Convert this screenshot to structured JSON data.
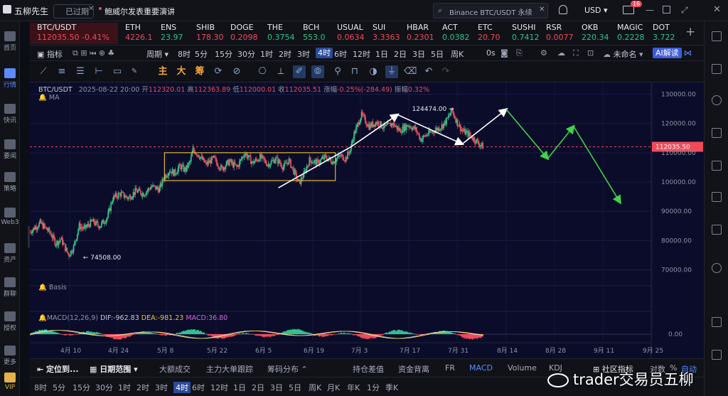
{
  "topbar": {
    "app_name": "五柳先生",
    "status": "已过期",
    "news": "鲍威尔发表重要演讲",
    "search_placeholder": "Binance BTC/USDT 永续",
    "currency": "USD",
    "notification_count": "16"
  },
  "leftnav": [
    {
      "label": "首页"
    },
    {
      "label": "行情"
    },
    {
      "label": "快讯"
    },
    {
      "label": "要闻"
    },
    {
      "label": "策略"
    },
    {
      "label": "Web3"
    },
    {
      "label": "资产"
    },
    {
      "label": "群聊"
    },
    {
      "label": "授权"
    },
    {
      "label": "更多"
    },
    {
      "label": "VIP"
    }
  ],
  "tickers": [
    {
      "name": "BTC/USDT",
      "price": "112035.50",
      "change": "-0.41%"
    },
    {
      "name": "ETH",
      "price": "4226.1"
    },
    {
      "name": "ENS",
      "price": "23.97"
    },
    {
      "name": "SHIB",
      "price": "178.30"
    },
    {
      "name": "DOGE",
      "price": "0.2098"
    },
    {
      "name": "THE",
      "price": "0.3754"
    },
    {
      "name": "BCH",
      "price": "553.0"
    },
    {
      "name": "USUAL",
      "price": "0.0634"
    },
    {
      "name": "SUI",
      "price": "3.3363"
    },
    {
      "name": "HBAR",
      "price": "0.2301"
    },
    {
      "name": "ACT",
      "price": "0.0382"
    },
    {
      "name": "ETC",
      "price": "20.70"
    },
    {
      "name": "SUSHI",
      "price": "0.7412"
    },
    {
      "name": "RSR",
      "price": "0.0077"
    },
    {
      "name": "OKB",
      "price": "220.34"
    },
    {
      "name": "MAGIC",
      "price": "0.2228"
    },
    {
      "name": "DOT",
      "price": "3.722"
    }
  ],
  "timeframes": {
    "indicator": "指标",
    "period": "周期",
    "items": [
      "8时",
      "5分",
      "15分",
      "30分",
      "1时",
      "2时",
      "3时",
      "4时",
      "6时",
      "12时",
      "1日",
      "2日",
      "3日",
      "5日",
      "周K"
    ],
    "active": "4时",
    "seconds": "0s",
    "layout_name": "未命名",
    "ai_label": "AI解读"
  },
  "tools": {
    "cn": [
      "主",
      "大",
      "筹"
    ]
  },
  "chart_info": {
    "symbol": "BTC/USDT",
    "time": "2025-08-22 20:00",
    "open_label": "开",
    "open": "112320.01",
    "high_label": "高",
    "high": "112363.89",
    "low_label": "低",
    "low": "112000.01",
    "close_label": "收",
    "close": "112035.51",
    "change_label": "涨幅",
    "change": "-0.25%(-284.49)",
    "amp_label": "振幅",
    "amp": "0.32%",
    "ma_label": "MA",
    "basis_label": "Basis",
    "macd_label": "MACD(12,26,9)",
    "dif": "DIF:-962.83",
    "dea": "DEA:-981.23",
    "macd": "MACD:36.80",
    "macd_zero": "0.00"
  },
  "chart_data": {
    "type": "candlestick",
    "y_ticks": [
      70000,
      80000,
      90000,
      100000,
      110000,
      120000,
      130000
    ],
    "y_tick_labels": [
      "70000.00",
      "80000.00",
      "90000.00",
      "100000.00",
      "110000.00",
      "120000.00",
      "130000.00"
    ],
    "x_tick_labels": [
      "4月 10",
      "4月 24",
      "5月 8",
      "5月 22",
      "6月 5",
      "6月 19",
      "7月 3",
      "7月 17",
      "7月 31",
      "8月 14",
      "8月 28",
      "9月 11",
      "9月 25"
    ],
    "ylim": [
      66000,
      134000
    ],
    "low_marker": {
      "label": "74508.00",
      "value": 74508
    },
    "high_marker": {
      "label": "124474.00",
      "value": 124474
    },
    "last_price": 112035.5,
    "last_price_label": "112035.50",
    "price_path": [
      [
        0,
        83000
      ],
      [
        4,
        86000
      ],
      [
        8,
        82500
      ],
      [
        10,
        79000
      ],
      [
        12,
        80500
      ],
      [
        15,
        75000
      ],
      [
        17,
        78000
      ],
      [
        19,
        85000
      ],
      [
        21,
        84000
      ],
      [
        24,
        86500
      ],
      [
        27,
        85000
      ],
      [
        30,
        88000
      ],
      [
        32,
        94500
      ],
      [
        35,
        96000
      ],
      [
        38,
        94500
      ],
      [
        41,
        97000
      ],
      [
        44,
        96000
      ],
      [
        47,
        98500
      ],
      [
        50,
        97500
      ],
      [
        52,
        102000
      ],
      [
        54,
        104000
      ],
      [
        56,
        103000
      ],
      [
        58,
        105500
      ],
      [
        60,
        104000
      ],
      [
        62,
        107000
      ],
      [
        63,
        111000
      ],
      [
        65,
        109500
      ],
      [
        68,
        106000
      ],
      [
        71,
        108000
      ],
      [
        74,
        104500
      ],
      [
        77,
        107000
      ],
      [
        80,
        105000
      ],
      [
        83,
        110000
      ],
      [
        86,
        106500
      ],
      [
        89,
        108500
      ],
      [
        92,
        106000
      ],
      [
        95,
        108000
      ],
      [
        98,
        105000
      ],
      [
        100,
        107500
      ],
      [
        102,
        103500
      ],
      [
        104,
        99500
      ],
      [
        106,
        103000
      ],
      [
        108,
        107500
      ],
      [
        111,
        106500
      ],
      [
        114,
        108500
      ],
      [
        117,
        107000
      ],
      [
        120,
        109000
      ],
      [
        122,
        108000
      ],
      [
        124,
        111500
      ],
      [
        125,
        116000
      ],
      [
        126,
        118000
      ],
      [
        128,
        123000
      ],
      [
        131,
        119000
      ],
      [
        134,
        120500
      ],
      [
        137,
        118500
      ],
      [
        140,
        120000
      ],
      [
        143,
        117500
      ],
      [
        146,
        119500
      ],
      [
        149,
        118000
      ],
      [
        151,
        114500
      ],
      [
        153,
        116000
      ],
      [
        156,
        117500
      ],
      [
        159,
        119000
      ],
      [
        161,
        121000
      ],
      [
        163,
        124500
      ],
      [
        165,
        120500
      ],
      [
        167,
        117500
      ],
      [
        170,
        116000
      ],
      [
        173,
        113500
      ],
      [
        175,
        112035
      ]
    ],
    "x_max": 240,
    "consolidation_box": {
      "x0": 52,
      "x1": 118,
      "y0": 100500,
      "y1": 110000
    },
    "arrows_white": [
      [
        [
          96,
          98000
        ],
        [
          124,
          112000
        ],
        [
          142,
          123000
        ]
      ],
      [
        [
          142,
          123000
        ],
        [
          167,
          113000
        ]
      ],
      [
        [
          167,
          113000
        ],
        [
          184,
          124800
        ]
      ]
    ],
    "arrows_green": [
      [
        [
          184,
          124800
        ],
        [
          200,
          108000
        ]
      ],
      [
        [
          200,
          108000
        ],
        [
          210,
          119000
        ]
      ],
      [
        [
          210,
          119000
        ],
        [
          228,
          93000
        ]
      ]
    ]
  },
  "indicators": [
    "持仓差值",
    "资金背离",
    "FR",
    "MACD",
    "Volume",
    "KDJ"
  ],
  "bottombar": {
    "locate": "定位到...",
    "date_range": "日期范围",
    "big_trades": "大额成交",
    "main_trades": "主力大单跟踪",
    "chip": "筹码分布",
    "active_indicator": "MACD",
    "community": "社区指标",
    "compare": "对数",
    "percent": "%",
    "auto": "自动"
  },
  "timeframes2": [
    "8时",
    "5分",
    "15分",
    "30分",
    "1时",
    "2时",
    "3时",
    "4时",
    "6时",
    "12时",
    "1日",
    "2日",
    "3日",
    "5日",
    "周K",
    "月K",
    "年K",
    "1分",
    "季K"
  ],
  "timeframes2_active": "4时",
  "watermark": "trader交易员五柳"
}
